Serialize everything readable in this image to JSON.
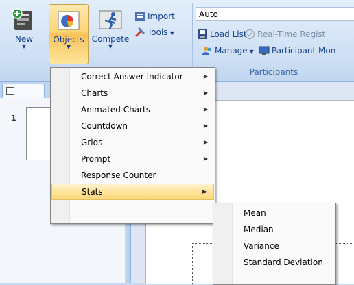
{
  "ribbon": {
    "buttons": {
      "new": "New",
      "objects": "Objects",
      "compete": "Compete",
      "import": "Import",
      "tools": "Tools",
      "load_list": "Load List",
      "real_time": "Real-Time Regist",
      "manage": "Manage",
      "participant_monitor": "Participant Mon"
    },
    "combo_value": "Auto",
    "group_label": "Participants"
  },
  "slides": {
    "number": "1"
  },
  "objects_menu": {
    "items": [
      {
        "label": "Correct Answer Indicator",
        "submenu": true
      },
      {
        "label": "Charts",
        "submenu": true
      },
      {
        "label": "Animated Charts",
        "submenu": true
      },
      {
        "label": "Countdown",
        "submenu": true
      },
      {
        "label": "Grids",
        "submenu": true
      },
      {
        "label": "Prompt",
        "submenu": true
      },
      {
        "label": "Response Counter",
        "submenu": false
      },
      {
        "label": "Stats",
        "submenu": true,
        "highlighted": true
      }
    ]
  },
  "stats_menu": {
    "items": [
      {
        "label": "Mean"
      },
      {
        "label": "Median"
      },
      {
        "label": "Variance"
      },
      {
        "label": "Standard Deviation"
      }
    ]
  },
  "colors": {
    "ribbon_text": "#15428b",
    "highlight": "#fee49a",
    "ribbon_bg": "#cfe0f5"
  }
}
